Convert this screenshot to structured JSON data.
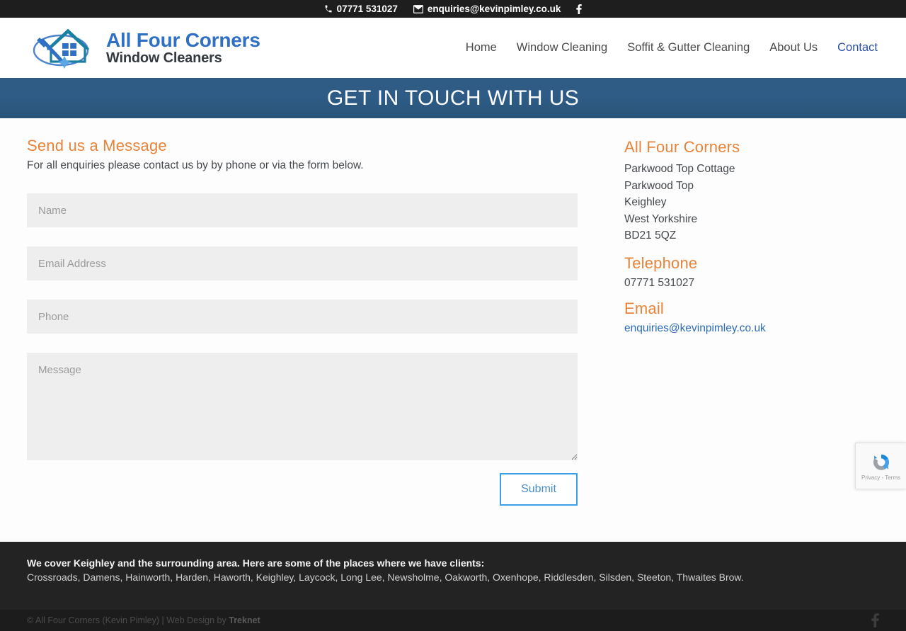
{
  "topbar": {
    "phone": "07771 531027",
    "email": "enquiries@kevinpimley.co.uk",
    "phone_icon": "phone-icon",
    "email_icon": "envelope-icon",
    "social_icon": "facebook-icon"
  },
  "header": {
    "logo_line1": "All Four Corners",
    "logo_line2": "Window Cleaners",
    "nav": [
      {
        "label": "Home",
        "active": false
      },
      {
        "label": "Window Cleaning",
        "active": false
      },
      {
        "label": "Soffit & Gutter Cleaning",
        "active": false
      },
      {
        "label": "About Us",
        "active": false
      },
      {
        "label": "Contact",
        "active": true
      }
    ]
  },
  "banner": {
    "title": "GET IN TOUCH WITH US",
    "bg_color": "#2e5c86"
  },
  "form_section": {
    "heading": "Send us a Message",
    "intro": "For all enquiries please contact us by by phone or via the form below.",
    "fields": {
      "name_placeholder": "Name",
      "name_value": "",
      "email_placeholder": "Email Address",
      "email_value": "",
      "phone_placeholder": "Phone",
      "phone_value": "",
      "message_placeholder": "Message",
      "message_value": ""
    },
    "submit_label": "Submit"
  },
  "contact_panel": {
    "company_heading": "All Four Corners",
    "address": [
      "Parkwood Top Cottage",
      "Parkwood Top",
      "Keighley",
      "West Yorkshire",
      "BD21 5QZ"
    ],
    "telephone_heading": "Telephone",
    "telephone": "07771 531027",
    "email_heading": "Email",
    "email": "enquiries@kevinpimley.co.uk",
    "accent_color": "#e8833a"
  },
  "recaptcha": {
    "text": "Privacy - Terms",
    "logo_icon": "recaptcha-icon"
  },
  "footer": {
    "coverage_heading": "We cover Keighley and the surrounding area. Here are some of the places where we have clients:",
    "coverage_list": "Crossroads, Damens, Hainworth, Harden, Haworth, Keighley, Laycock, Long Lee, Newsholme, Oakworth, Oxenhope, Riddlesden, Silsden, Steeton, Thwaites Brow.",
    "copyright_prefix": "© All Four Corners (Kevin Pimley) | Web Design by ",
    "copyright_brand": "Treknet",
    "social_icon": "facebook-icon"
  }
}
